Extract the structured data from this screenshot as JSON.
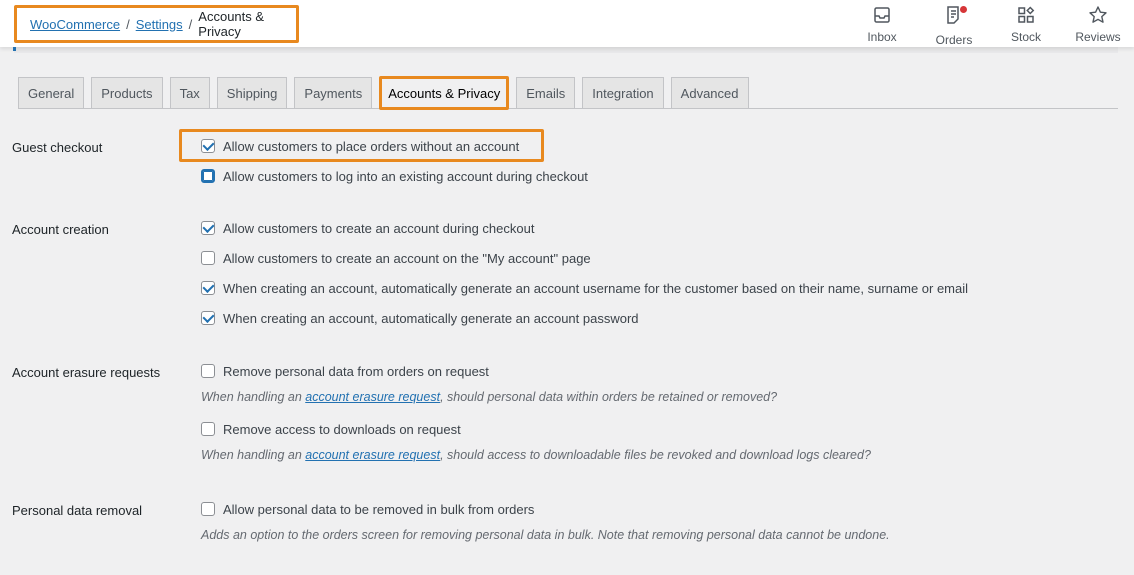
{
  "breadcrumb": {
    "items": [
      {
        "label": "WooCommerce",
        "link": true
      },
      {
        "label": "Settings",
        "link": true
      },
      {
        "label": "Accounts & Privacy",
        "link": false
      }
    ],
    "separator": "/"
  },
  "activity_bar": [
    {
      "label": "Inbox",
      "icon": "inbox-icon"
    },
    {
      "label": "Orders",
      "icon": "orders-icon",
      "notification": true
    },
    {
      "label": "Stock",
      "icon": "stock-icon"
    },
    {
      "label": "Reviews",
      "icon": "star-icon"
    }
  ],
  "tabs": [
    {
      "label": "General",
      "active": false
    },
    {
      "label": "Products",
      "active": false
    },
    {
      "label": "Tax",
      "active": false
    },
    {
      "label": "Shipping",
      "active": false
    },
    {
      "label": "Payments",
      "active": false
    },
    {
      "label": "Accounts & Privacy",
      "active": true
    },
    {
      "label": "Emails",
      "active": false
    },
    {
      "label": "Integration",
      "active": false
    },
    {
      "label": "Advanced",
      "active": false
    }
  ],
  "sections": {
    "guest_checkout": {
      "label": "Guest checkout",
      "options": [
        {
          "label": "Allow customers to place orders without an account",
          "checked": true
        },
        {
          "label": "Allow customers to log into an existing account during checkout",
          "checked": false
        }
      ]
    },
    "account_creation": {
      "label": "Account creation",
      "options": [
        {
          "label": "Allow customers to create an account during checkout",
          "checked": true
        },
        {
          "label": "Allow customers to create an account on the \"My account\" page",
          "checked": false
        },
        {
          "label": "When creating an account, automatically generate an account username for the customer based on their name, surname or email",
          "checked": true
        },
        {
          "label": "When creating an account, automatically generate an account password",
          "checked": true
        }
      ]
    },
    "account_erasure": {
      "label": "Account erasure requests",
      "options": [
        {
          "label": "Remove personal data from orders on request",
          "checked": false,
          "desc_prefix": "When handling an ",
          "desc_link": "account erasure request",
          "desc_suffix": ", should personal data within orders be retained or removed?"
        },
        {
          "label": "Remove access to downloads on request",
          "checked": false,
          "desc_prefix": "When handling an ",
          "desc_link": "account erasure request",
          "desc_suffix": ", should access to downloadable files be revoked and download logs cleared?"
        }
      ]
    },
    "personal_data_removal": {
      "label": "Personal data removal",
      "options": [
        {
          "label": "Allow personal data to be removed in bulk from orders",
          "checked": false,
          "desc": "Adds an option to the orders screen for removing personal data in bulk. Note that removing personal data cannot be undone."
        }
      ]
    }
  },
  "colors": {
    "accent": "#2271b1",
    "highlight": "#e8891f",
    "notification": "#d63638"
  }
}
